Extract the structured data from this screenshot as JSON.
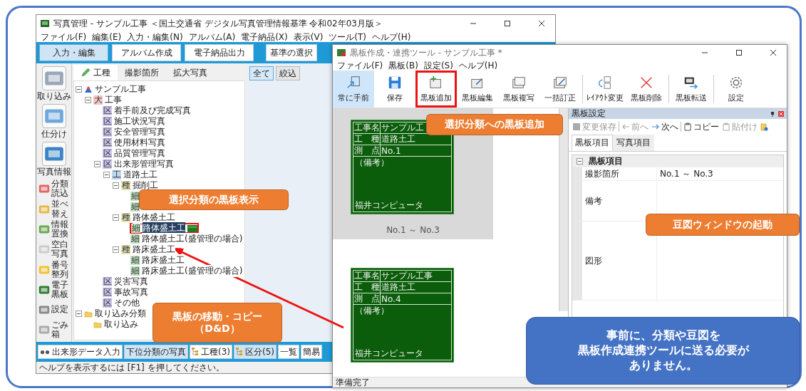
{
  "photo_window": {
    "title": "写真管理 - サンプル工事 ＜国土交通省 デジタル写真管理情報基準 令和02年03月版＞",
    "menu": [
      "ファイル(F)",
      "編集(E)",
      "入力・編集(N)",
      "アルバム(A)",
      "電子納品(X)",
      "表示(V)",
      "ツール(T)",
      "ヘルプ(H)"
    ],
    "tabs": [
      {
        "label": "入力・編集",
        "selected": true
      },
      {
        "label": "アルバム作成",
        "selected": false
      },
      {
        "label": "電子納品出力",
        "selected": false
      },
      {
        "label": "基準の選択",
        "selected": false
      }
    ],
    "sidebar": [
      {
        "label": "取り込み",
        "kind": "large"
      },
      {
        "label": "仕分け",
        "kind": "large"
      },
      {
        "label": "写真情報",
        "kind": "large"
      },
      {
        "label": "分類読込",
        "kind": "small"
      },
      {
        "label": "並べ替え",
        "kind": "small"
      },
      {
        "label": "情報置換",
        "kind": "small"
      },
      {
        "label": "空白写真",
        "kind": "small"
      },
      {
        "label": "番号整列",
        "kind": "small"
      },
      {
        "label": "電子黒板",
        "kind": "small"
      },
      {
        "label": "設定",
        "kind": "small"
      },
      {
        "label": "ごみ箱",
        "kind": "small"
      }
    ],
    "tree_tabs": [
      {
        "label": "工種",
        "selected": true
      },
      {
        "label": "撮影箇所",
        "selected": false
      },
      {
        "label": "拡大写真",
        "selected": false
      }
    ],
    "tree": [
      {
        "kind": "root",
        "label": "サンプル工事",
        "selected": false,
        "children": [
          {
            "kind": "badge",
            "badge": "大",
            "color": "#f5c6c6",
            "label": "工事",
            "selected": false,
            "children": [
              {
                "kind": "badge",
                "badge": "区",
                "color": "#cbc5ec",
                "label": "着手前及び完成写真",
                "selected": false
              },
              {
                "kind": "badge",
                "badge": "区",
                "color": "#cbc5ec",
                "label": "施工状況写真",
                "selected": false
              },
              {
                "kind": "badge",
                "badge": "区",
                "color": "#cbc5ec",
                "label": "安全管理写真",
                "selected": false
              },
              {
                "kind": "badge",
                "badge": "区",
                "color": "#cbc5ec",
                "label": "使用材料写真",
                "selected": false
              },
              {
                "kind": "badge",
                "badge": "区",
                "color": "#cbc5ec",
                "label": "品質管理写真",
                "selected": false
              },
              {
                "kind": "badge",
                "badge": "区",
                "color": "#cbc5ec",
                "label": "出来形管理写真",
                "selected": false,
                "children": [
                  {
                    "kind": "badge",
                    "badge": "工",
                    "color": "#bcd7f0",
                    "label": "道路土工",
                    "selected": false,
                    "children": [
                      {
                        "kind": "badge",
                        "badge": "種",
                        "color": "#e8e6b4",
                        "label": "掘削工",
                        "selected": false,
                        "children": [
                          {
                            "kind": "badge",
                            "badge": "細",
                            "color": "#c3e3c3",
                            "selected": false
                          },
                          {
                            "kind": "badge",
                            "badge": "細",
                            "color": "#c3e3c3",
                            "selected": false
                          }
                        ]
                      },
                      {
                        "kind": "badge",
                        "badge": "種",
                        "color": "#e8e6b4",
                        "label": "路体盛土工",
                        "selected": false,
                        "children": [
                          {
                            "kind": "badge",
                            "badge": "細",
                            "color": "#c3e3c3",
                            "label": "路体盛土工",
                            "selected": true
                          },
                          {
                            "kind": "badge",
                            "badge": "細",
                            "color": "#c3e3c3",
                            "label": "路体盛土工(盛管理の場合)",
                            "selected": false
                          }
                        ]
                      },
                      {
                        "kind": "badge",
                        "badge": "種",
                        "color": "#e8e6b4",
                        "label": "路床盛土工",
                        "selected": false,
                        "children": [
                          {
                            "kind": "badge",
                            "badge": "細",
                            "color": "#c3e3c3",
                            "label": "路床盛土工",
                            "selected": false
                          },
                          {
                            "kind": "badge",
                            "badge": "細",
                            "color": "#c3e3c3",
                            "label": "路床盛土工(盛管理の場合)",
                            "selected": false
                          }
                        ]
                      }
                    ]
                  }
                ]
              },
              {
                "kind": "badge",
                "badge": "区",
                "color": "#cbc5ec",
                "label": "災害写真",
                "selected": false
              },
              {
                "kind": "badge",
                "badge": "区",
                "color": "#cbc5ec",
                "label": "事故写真",
                "selected": false
              },
              {
                "kind": "badge",
                "badge": "区",
                "color": "#cbc5ec",
                "label": "その他",
                "selected": false
              }
            ]
          }
        ]
      },
      {
        "kind": "folder",
        "label": "取り込み分類",
        "selected": false,
        "children": [
          {
            "kind": "folder",
            "label": "取り込み",
            "selected": false
          }
        ]
      }
    ],
    "filter_buttons": [
      {
        "label": "全て",
        "selected": true
      },
      {
        "label": "絞込",
        "selected": false
      }
    ],
    "bottom_buttons": [
      {
        "label": "出来形データ入力",
        "selected": false,
        "kind": "dots"
      },
      {
        "label": "下位分類の写真",
        "selected": true,
        "kind": "plain"
      },
      {
        "label": "工種(3)",
        "selected": false,
        "kind": "tree"
      },
      {
        "label": "区分(5)",
        "selected": true,
        "kind": "tree"
      },
      {
        "label": "一覧",
        "selected": false,
        "kind": "plain"
      },
      {
        "label": "簡易",
        "selected": false,
        "kind": "plain"
      }
    ],
    "status_bar": "ヘルプを表示するには [F1] を押してください。"
  },
  "board_window": {
    "title": "黒板作成・連携ツール - サンプル工事 *",
    "menu": [
      "ファイル(F)",
      "黒板(B)",
      "設定(S)",
      "ヘルプ(H)"
    ],
    "toolbar": [
      {
        "label": "常に手前",
        "selected": true,
        "highlighted": false
      },
      {
        "label": "保存",
        "selected": false,
        "highlighted": false
      },
      {
        "label": "黒板追加",
        "selected": false,
        "highlighted": true
      },
      {
        "label": "黒板編集",
        "selected": false,
        "highlighted": false
      },
      {
        "label": "黒板複写",
        "selected": false,
        "highlighted": false
      },
      {
        "label": "一括訂正",
        "selected": false,
        "highlighted": false
      },
      {
        "label": "ﾚｲｱｳﾄ変更",
        "selected": false,
        "highlighted": false
      },
      {
        "label": "黒板削除",
        "selected": false,
        "highlighted": false
      },
      {
        "label": "黒板転送",
        "selected": false,
        "highlighted": false
      },
      {
        "label": "設定",
        "selected": false,
        "highlighted": false
      }
    ],
    "boards": [
      {
        "selected": true,
        "rows": [
          {
            "label": "工事名",
            "value": "サンプル工"
          },
          {
            "label": "工　種",
            "value": "道路土工"
          },
          {
            "label": "測　点",
            "value": "No.1"
          }
        ],
        "remarks": "（備考）",
        "footer": "福井コンピュータ",
        "caption": "No.1 ～ No.3"
      },
      {
        "selected": false,
        "rows": [
          {
            "label": "工事名",
            "value": "サンプル工事"
          },
          {
            "label": "工　種",
            "value": "道路土工"
          },
          {
            "label": "測　点",
            "value": "No.4"
          }
        ],
        "remarks": "（備考）",
        "footer": "福井コンピュータ"
      }
    ],
    "settings": {
      "title": "黒板設定",
      "toolbar": [
        {
          "label": "変更保存",
          "disabled": true,
          "kind": "save"
        },
        {
          "label": "前へ",
          "disabled": true,
          "kind": "prev"
        },
        {
          "label": "次へ",
          "disabled": false,
          "kind": "next"
        },
        {
          "label": "コピー",
          "disabled": false,
          "kind": "copy"
        },
        {
          "label": "貼付け",
          "disabled": true,
          "kind": "paste"
        }
      ],
      "tabs": [
        {
          "label": "黒板項目",
          "selected": true
        },
        {
          "label": "写真項目",
          "selected": false
        }
      ],
      "section": "黒板項目",
      "rows": [
        {
          "name": "撮影箇所",
          "value": "No.1 ～ No.3",
          "kind": "text"
        },
        {
          "name": "備考",
          "kind": "memo"
        },
        {
          "name": "図形",
          "kind": "figure"
        }
      ]
    },
    "status_bar": "準備完了"
  },
  "callouts": [
    {
      "color": "#ed7d31",
      "lines": [
        "選択分類の黒板表示"
      ]
    },
    {
      "color": "#ed7d31",
      "lines": [
        "選択分類への黒板追加"
      ]
    },
    {
      "color": "#ed7d31",
      "lines": [
        "豆図ウィンドウの起動"
      ]
    },
    {
      "color": "#ed7d31",
      "lines": [
        "黒板の移動・コピー",
        "（D&D）"
      ]
    },
    {
      "color": "#4472c4",
      "lines": [
        "事前に、分類や豆図を",
        "黒板作成連携ツールに送る必要が",
        "ありません。"
      ]
    }
  ]
}
